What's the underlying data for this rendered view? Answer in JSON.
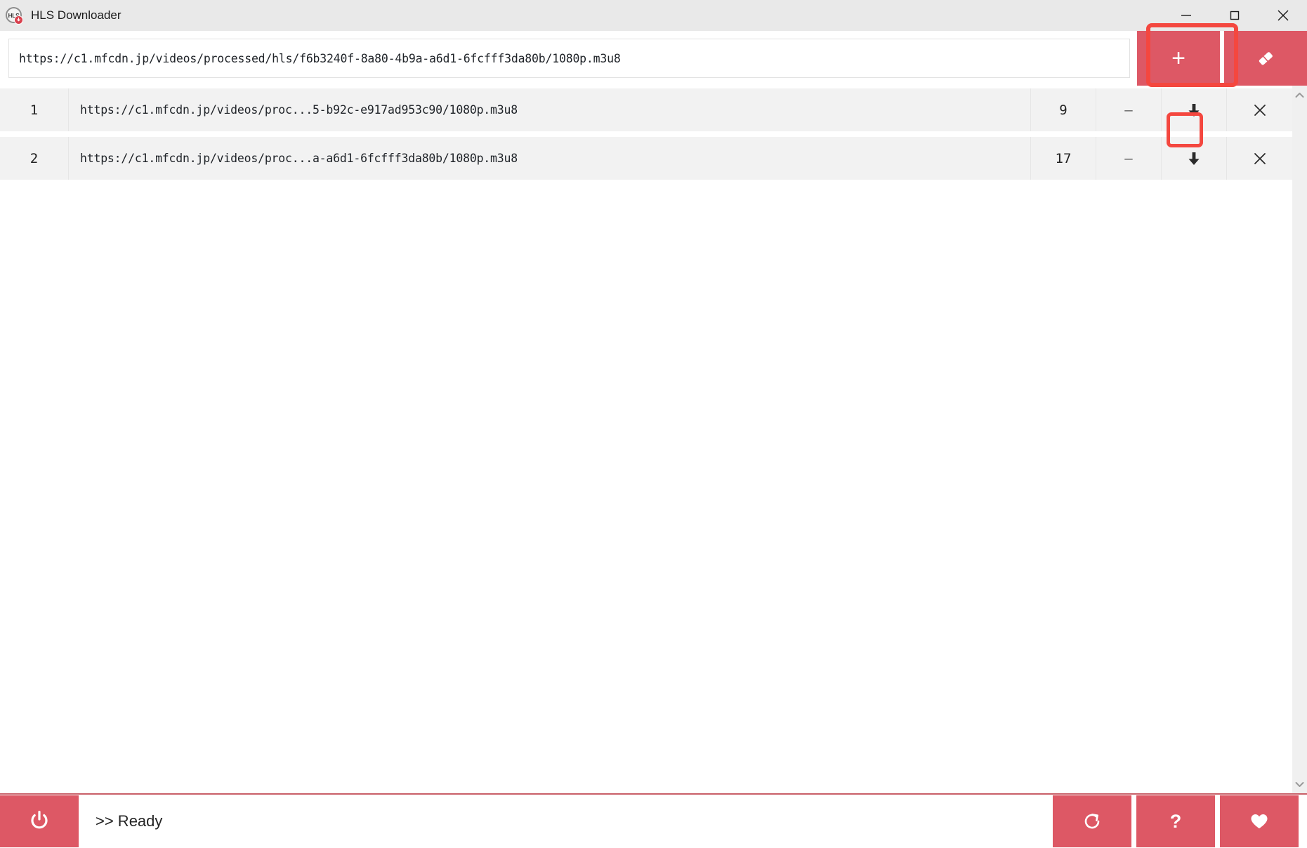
{
  "window": {
    "title": "HLS Downloader",
    "icon_label": "HLS",
    "minimize_label": "Minimize",
    "maximize_label": "Maximize",
    "close_label": "Close"
  },
  "colors": {
    "accent": "#dd5865",
    "highlight": "#f4473f",
    "row_background": "#f2f2f2",
    "titlebar_background": "#e9e9e9",
    "status_divider": "#c95f68"
  },
  "urlbar": {
    "value": "https://c1.mfcdn.jp/videos/processed/hls/f6b3240f-8a80-4b9a-a6d1-6fcfff3da80b/1080p.m3u8",
    "placeholder": "https://",
    "add_label": "+",
    "add_icon": "plus-icon",
    "clear_icon": "eraser-icon"
  },
  "list": {
    "rows": [
      {
        "index": "1",
        "url": "https://c1.mfcdn.jp/videos/proc...5-b92c-e917ad953c90/1080p.m3u8",
        "count": "9",
        "progress": "–",
        "download_icon": "download-arrow-icon",
        "remove_icon": "close-x-icon"
      },
      {
        "index": "2",
        "url": "https://c1.mfcdn.jp/videos/proc...a-a6d1-6fcfff3da80b/1080p.m3u8",
        "count": "17",
        "progress": "–",
        "download_icon": "download-arrow-icon",
        "remove_icon": "close-x-icon"
      }
    ],
    "scrollbar": {
      "up_icon": "chevron-up-icon",
      "down_icon": "chevron-down-icon"
    }
  },
  "statusbar": {
    "power_icon": "power-icon",
    "status_text": ">> Ready",
    "actions": [
      {
        "icon": "refresh-icon",
        "label": ""
      },
      {
        "icon": "help-icon",
        "label": "?"
      },
      {
        "icon": "heart-icon",
        "label": ""
      }
    ]
  },
  "annotations": {
    "add_button_highlight": "add-button-highlight",
    "download_button_highlight": "download-button-highlight"
  }
}
